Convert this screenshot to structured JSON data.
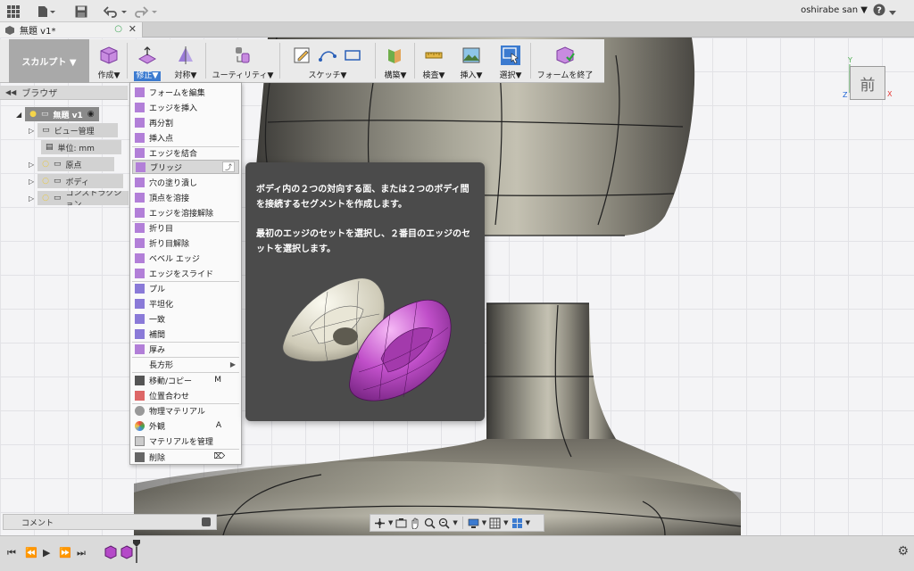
{
  "topbar": {
    "user": "oshirabe san ▼",
    "help": "?▼"
  },
  "tab": {
    "title": "無題 v1*",
    "status": "○",
    "close": "✕"
  },
  "workspace": {
    "label": "スカルプト ▼"
  },
  "toolbar": {
    "create": "作成▼",
    "modify": "修正▼",
    "symmetry": "対称▼",
    "utility": "ユーティリティ▼",
    "sketch": "スケッチ▼",
    "construct": "構築▼",
    "inspect": "検査▼",
    "insert": "挿入▼",
    "select": "選択▼",
    "finish": "フォームを終了"
  },
  "browser": {
    "header": "ブラウザ",
    "root": "無題 v1",
    "items": [
      "ビュー管理",
      "単位: mm",
      "原点",
      "ボディ",
      "コンストラクション"
    ]
  },
  "menu": {
    "items": [
      "フォームを編集",
      "エッジを挿入",
      "再分割",
      "挿入点",
      "エッジを結合",
      "ブリッジ",
      "穴の塗り潰し",
      "頂点を溶接",
      "エッジを溶接解除",
      "折り目",
      "折り目解除",
      "ベベル エッジ",
      "エッジをスライド",
      "プル",
      "平坦化",
      "一致",
      "補間",
      "厚み",
      "長方形",
      "移動/コピー",
      "位置合わせ",
      "物理マテリアル",
      "外観",
      "マテリアルを管理",
      "削除"
    ],
    "shortcuts": {
      "move": "M",
      "appearance": "A"
    }
  },
  "tooltip": {
    "line1": "ボディ内の２つの対向する面、または２つのボディ間を接続するセグメントを作成します。",
    "line2": "最初のエッジのセットを選択し、２番目のエッジのセットを選択します。"
  },
  "viewcube": {
    "face": "前",
    "axis_y": "Y",
    "axis_x": "X",
    "axis_z": "Z"
  },
  "comment": {
    "label": "コメント"
  },
  "colors": {
    "accent": "#3c7bd0",
    "form_purple": "#b449c8",
    "tooltip_bg": "#4b4b4b"
  }
}
